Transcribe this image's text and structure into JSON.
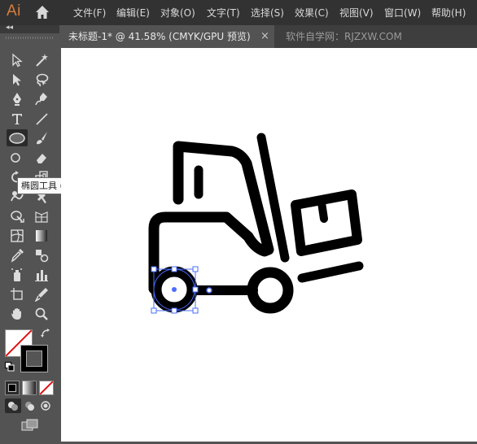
{
  "app": {
    "logo": "Ai"
  },
  "menu": [
    {
      "id": "file",
      "label": "文件(F)"
    },
    {
      "id": "edit",
      "label": "编辑(E)"
    },
    {
      "id": "object",
      "label": "对象(O)"
    },
    {
      "id": "type",
      "label": "文字(T)"
    },
    {
      "id": "select",
      "label": "选择(S)"
    },
    {
      "id": "effect",
      "label": "效果(C)"
    },
    {
      "id": "view",
      "label": "视图(V)"
    },
    {
      "id": "window",
      "label": "窗口(W)"
    },
    {
      "id": "help",
      "label": "帮助(H)"
    }
  ],
  "tabs": {
    "active": {
      "label": "未标题-1* @ 41.58% (CMYK/GPU 预览)",
      "close": "×"
    },
    "other": {
      "label": "软件自学网：RJZXW.COM"
    }
  },
  "toolbar": {
    "collapse_glyph": "◂◂",
    "tooltip": "椭圆工具 (L)",
    "selected_tool": "ellipse-tool"
  },
  "colors": {
    "menubar_bg": "#323232",
    "panel_bg": "#535353",
    "canvas_bg": "#ffffff",
    "selection": "#4a6cff",
    "logo": "#d77d3d",
    "artwork_stroke": "#000000"
  },
  "artwork": {
    "subject": "forklift-icon",
    "selected_object": "rear-wheel-ellipse"
  }
}
